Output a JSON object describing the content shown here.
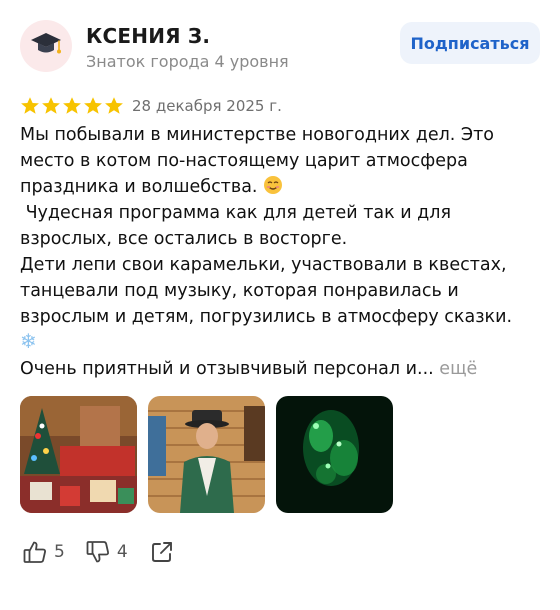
{
  "author": {
    "name": "КСЕНИЯ З.",
    "level": "Знаток города 4 уровня",
    "avatar_icon": "graduation-cap-icon"
  },
  "subscribe_label": "Подписаться",
  "review": {
    "rating": 5,
    "max_rating": 5,
    "date": "28 декабря 2025 г.",
    "lines": [
      "Мы побывали в министерстве новогодних дел. Это",
      "место в котом по-настоящему царит атмосфера",
      "праздника и волшебства.",
      " Чудесная программа как для детей так и для",
      "взрослых, все остались в восторге.",
      "Дети лепи свои карамельки, участвовали в квестах,",
      "танцевали под музыку, которая понравилась и",
      "взрослым и детям, погрузились в атмосферу сказки."
    ],
    "emoji_smile": "smiling-face-icon",
    "emoji_snow": "❄",
    "last_line": "Очень приятный и отзывчивый персонал и...",
    "more_label": "ещё"
  },
  "photos": [
    {
      "name": "photo-christmas-tree-hall"
    },
    {
      "name": "photo-person-in-costume"
    },
    {
      "name": "photo-green-lights-dark"
    }
  ],
  "actions": {
    "likes": "5",
    "dislikes": "4"
  },
  "colors": {
    "star": "#f7c300",
    "subscribe_bg": "#eef3fb",
    "subscribe_text": "#1f63c9",
    "avatar_bg": "#fbe9ea"
  }
}
